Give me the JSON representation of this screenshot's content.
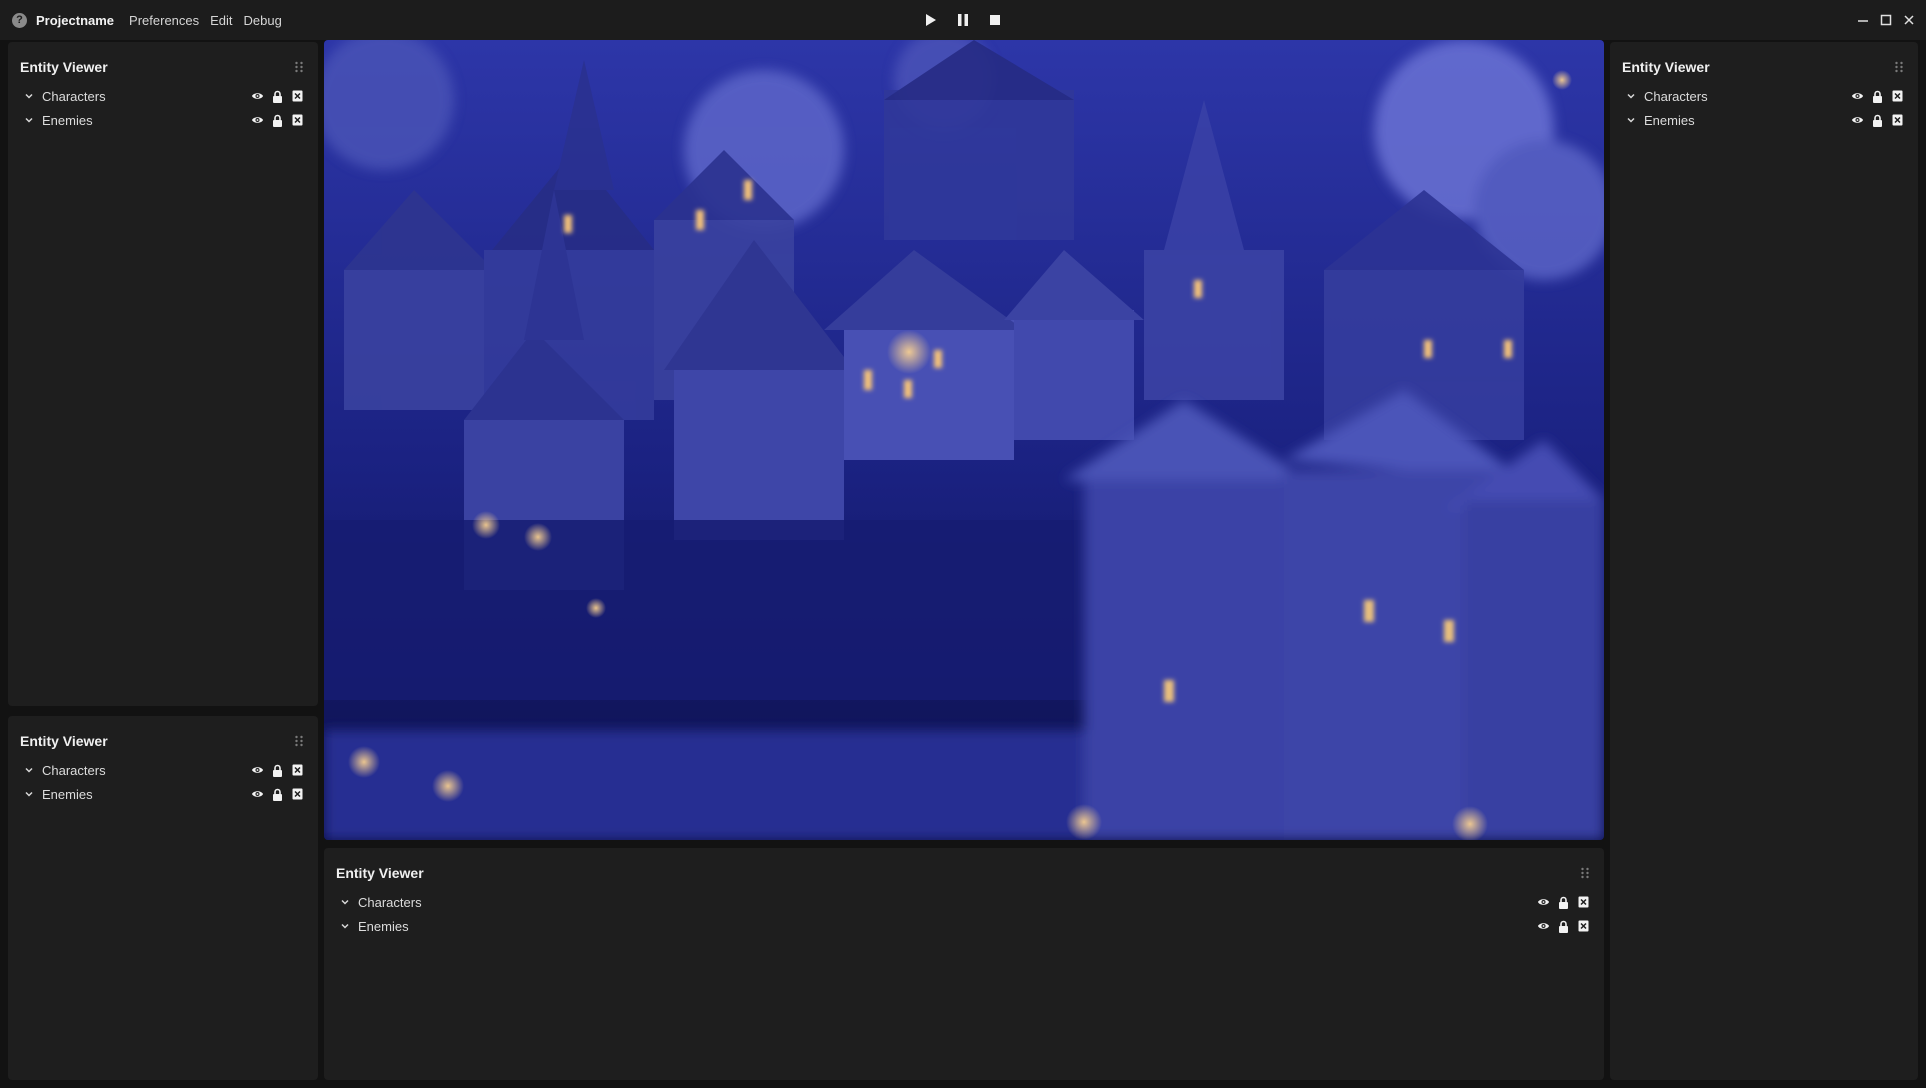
{
  "titlebar": {
    "logo_glyph": "?",
    "app_name": "Projectname",
    "menu": [
      "Preferences",
      "Edit",
      "Debug"
    ]
  },
  "playback": {
    "icons": [
      "play-icon",
      "pause-icon",
      "stop-icon"
    ]
  },
  "window_controls": {
    "icons": [
      "minimize-icon",
      "maximize-icon",
      "close-icon"
    ]
  },
  "panels": {
    "left_top": {
      "title": "Entity Viewer",
      "items": [
        {
          "label": "Characters"
        },
        {
          "label": "Enemies"
        }
      ]
    },
    "left_bottom": {
      "title": "Entity Viewer",
      "items": [
        {
          "label": "Characters"
        },
        {
          "label": "Enemies"
        }
      ]
    },
    "right": {
      "title": "Entity Viewer",
      "items": [
        {
          "label": "Characters"
        },
        {
          "label": "Enemies"
        }
      ]
    },
    "bottom": {
      "title": "Entity Viewer",
      "items": [
        {
          "label": "Characters"
        },
        {
          "label": "Enemies"
        }
      ]
    }
  },
  "row_action_icons": [
    "eye-icon",
    "lock-icon",
    "remove-icon"
  ],
  "viewport": {
    "description_icon": "scene-viewport"
  },
  "colors": {
    "background": "#121212",
    "panel": "#1e1e1e",
    "titlebar": "#1c1c1c",
    "scene_dark": "#0d1148",
    "scene_mid": "#2a33a8",
    "scene_light": "#6f78e0",
    "window_light": "#f4c27a"
  }
}
